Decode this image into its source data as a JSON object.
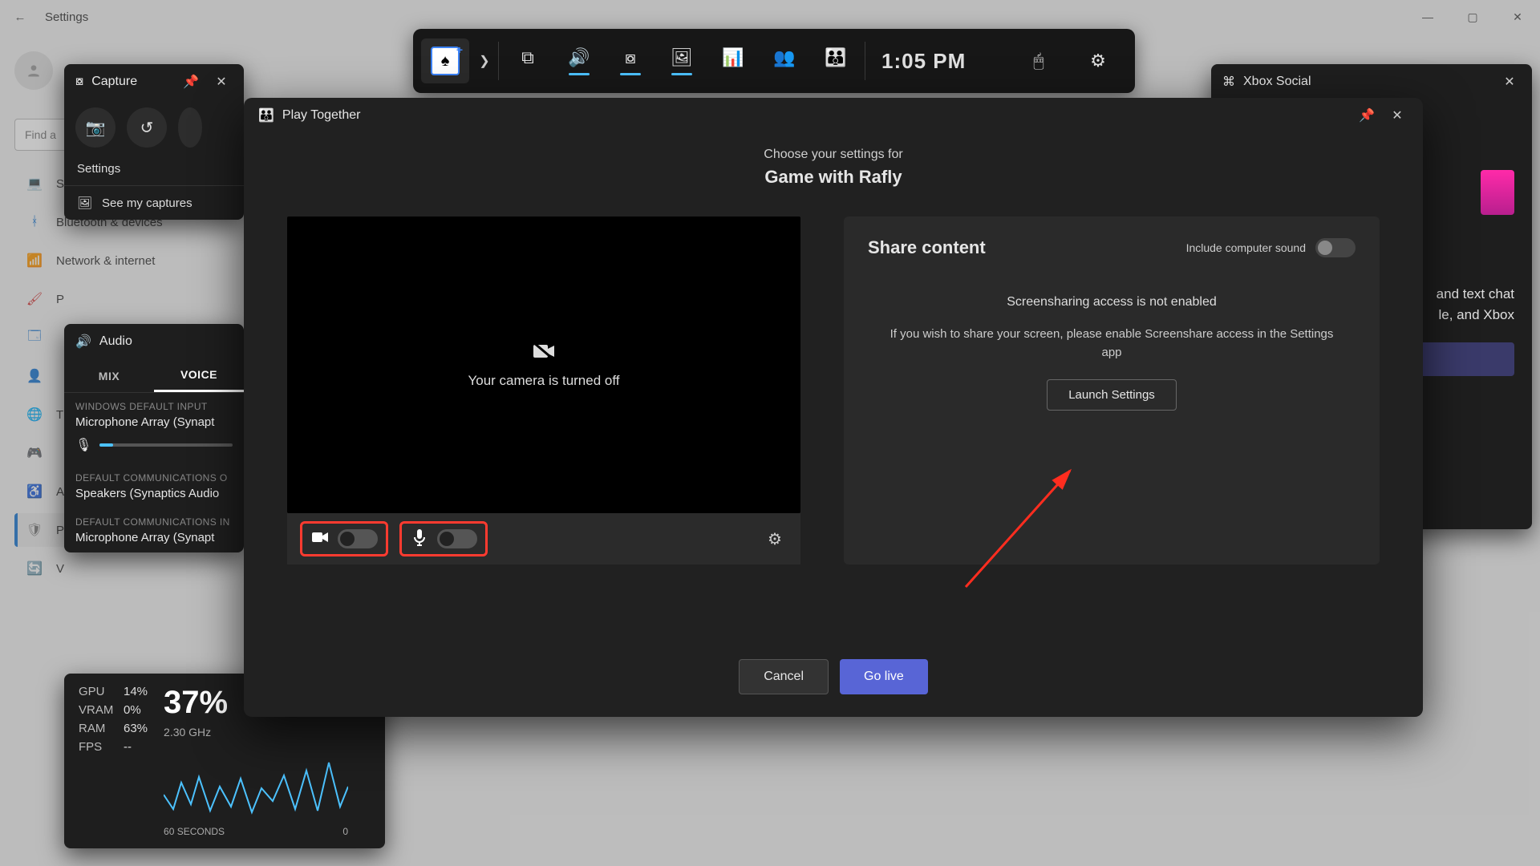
{
  "settings_window": {
    "title": "Settings",
    "search_placeholder": "Find a",
    "nav": [
      {
        "icon": "💻",
        "label": "S",
        "color": "#1976d2"
      },
      {
        "icon": "ᚼ",
        "label": "Bluetooth & devices",
        "color": "#1976d2"
      },
      {
        "icon": "📶",
        "label": "Network & internet",
        "color": "#1e88e5"
      },
      {
        "icon": "🖌",
        "label": "P",
        "color": "#d32f2f"
      },
      {
        "icon": "🗔",
        "label": "",
        "color": "#1976d2"
      },
      {
        "icon": "👤",
        "label": "",
        "color": "#1e88e5"
      },
      {
        "icon": "🌐",
        "label": "T",
        "color": "#039be5"
      },
      {
        "icon": "🎮",
        "label": "",
        "color": "#888"
      },
      {
        "icon": "♿",
        "label": "A",
        "color": "#1e88e5"
      },
      {
        "icon": "🛡",
        "label": "P",
        "color": "#777",
        "active": true
      },
      {
        "icon": "🔄",
        "label": "V",
        "color": "#039be5"
      }
    ]
  },
  "gamebar": {
    "time": "1:05 PM",
    "buttons": [
      {
        "name": "widgets",
        "glyph": "⧉",
        "underline": false
      },
      {
        "name": "audio",
        "glyph": "🔊",
        "underline": true
      },
      {
        "name": "capture",
        "glyph": "⧇",
        "underline": true
      },
      {
        "name": "gallery",
        "glyph": "🖼",
        "underline": true
      },
      {
        "name": "performance",
        "glyph": "📊",
        "underline": false
      },
      {
        "name": "xbox-social",
        "glyph": "👥",
        "underline": false
      },
      {
        "name": "teams",
        "glyph": "👪",
        "underline": false
      }
    ]
  },
  "capture": {
    "title": "Capture",
    "settings_label": "Settings",
    "see_captures": "See my captures"
  },
  "audio": {
    "title": "Audio",
    "tabs": {
      "mix": "MIX",
      "voice": "VOICE"
    },
    "sections": {
      "input_header": "WINDOWS DEFAULT INPUT",
      "input_device": "Microphone Array (Synapt",
      "comm_out_header": "DEFAULT COMMUNICATIONS O",
      "comm_out_device": "Speakers (Synaptics Audio",
      "comm_in_header": "DEFAULT COMMUNICATIONS IN",
      "comm_in_device": "Microphone Array (Synapt"
    }
  },
  "perf": {
    "rows": [
      {
        "label": "GPU",
        "value": "14%"
      },
      {
        "label": "VRAM",
        "value": "0%"
      },
      {
        "label": "RAM",
        "value": "63%"
      },
      {
        "label": "FPS",
        "value": "--"
      }
    ],
    "big_pct": "37%",
    "clock": "2.30 GHz",
    "x_label": "60 SECONDS",
    "y_max": "0"
  },
  "social": {
    "title": "Xbox Social",
    "body1": "and text chat",
    "body2": "le, and Xbox"
  },
  "play_together": {
    "brand": "Play Together",
    "subtitle": "Choose your settings for",
    "title": "Game with Rafly",
    "camera_off": "Your camera is turned off",
    "share_heading": "Share content",
    "include_sound": "Include computer sound",
    "share_status": "Screensharing access is not enabled",
    "share_desc": "If you wish to share your screen, please enable Screenshare access in the Settings app",
    "launch": "Launch Settings",
    "cancel": "Cancel",
    "go_live": "Go live"
  }
}
